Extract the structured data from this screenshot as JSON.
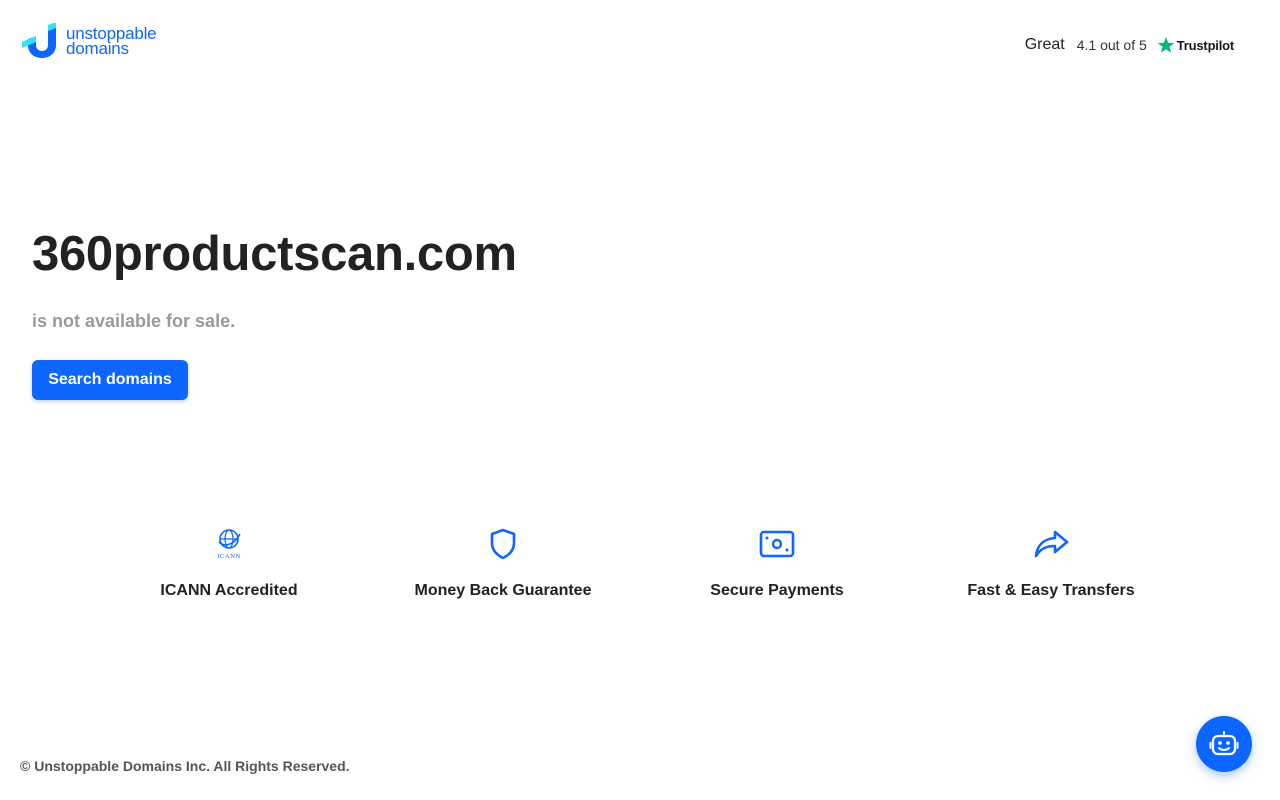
{
  "header": {
    "logo": {
      "line1": "unstoppable",
      "line2": "domains"
    },
    "trustpilot": {
      "rating_word": "Great",
      "score_text": "4.1 out of 5",
      "brand": "Trustpilot",
      "star_color": "#00b67a"
    }
  },
  "hero": {
    "domain": "360productscan.com",
    "status": "is not available for sale.",
    "search_button": "Search domains"
  },
  "features": [
    {
      "icon": "icann-globe-icon",
      "label": "ICANN Accredited"
    },
    {
      "icon": "shield-icon",
      "label": "Money Back Guarantee"
    },
    {
      "icon": "payment-card-icon",
      "label": "Secure Payments"
    },
    {
      "icon": "share-arrow-icon",
      "label": "Fast & Easy Transfers"
    }
  ],
  "icann_badge_text": "ICANN",
  "footer": {
    "copyright": "© Unstoppable Domains Inc. All Rights Reserved."
  },
  "chat": {
    "icon": "chatbot-icon"
  },
  "colors": {
    "accent": "#0d67fe",
    "muted_text": "#9a9a9a",
    "trustpilot_green": "#00b67a"
  }
}
